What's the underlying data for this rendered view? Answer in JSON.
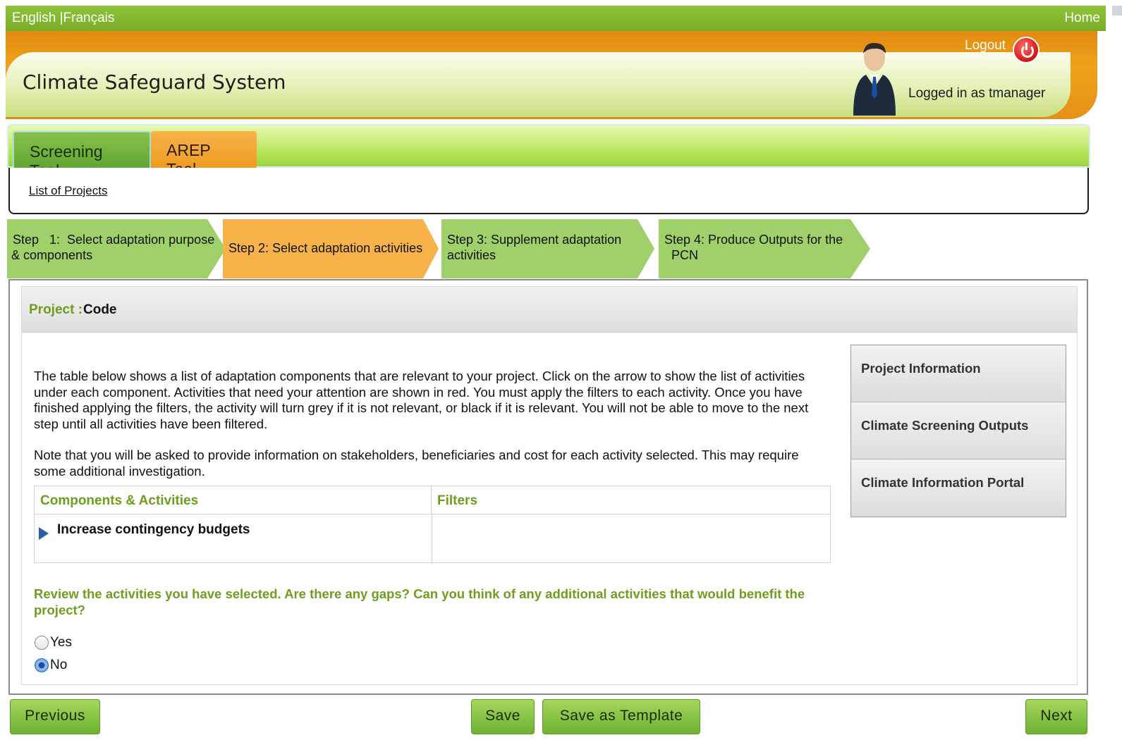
{
  "lang": {
    "english": "English",
    "separator": " |",
    "french": "Français"
  },
  "home": "Home",
  "header": {
    "title": "Climate Safeguard System",
    "logout": "Logout",
    "logged_in": "Logged in as tmanager"
  },
  "tabs": [
    {
      "label": "Screening Tool",
      "active": true
    },
    {
      "label": "AREP Tool",
      "active": false
    }
  ],
  "breadcrumb": {
    "link": "List of Projects"
  },
  "steps": [
    {
      "line1": "Step   1:  Select adaptation purpose",
      "line2": "& components",
      "state": "done"
    },
    {
      "line1": "Step 2: Select adaptation activities",
      "line2": "",
      "state": "current"
    },
    {
      "line1": "Step 3: Supplement adaptation",
      "line2": "activities",
      "state": "todo"
    },
    {
      "line1": "Step 4: Produce Outputs for the",
      "line2": "  PCN",
      "state": "todo"
    }
  ],
  "project": {
    "label": "Project : ",
    "code": "Code"
  },
  "intro": "The table below shows a list of adaptation components that are relevant to your project. Click on the arrow to show the list of activities under each component. Activities that need your attention are shown in red. You must apply the filters to each activity. Once you have finished applying the filters, the activity will turn grey if it is not relevant, or black if it is relevant. You will not be able to move to the next step until all activities have been filtered.",
  "note": "Note that you will be asked to provide information on stakeholders, beneficiaries and cost for each activity selected. This may require some additional investigation.",
  "table": {
    "headers": [
      "Components & Activities",
      "Filters"
    ],
    "rows": [
      {
        "component": "Increase contingency budgets",
        "filters": ""
      }
    ]
  },
  "question": "Review the activities you have selected. Are there any gaps? Can you think of any additional activities that would benefit the project?",
  "options": [
    {
      "label": "Yes",
      "selected": false
    },
    {
      "label": "No",
      "selected": true
    }
  ],
  "sidemenu": [
    "Project Information",
    "Climate Screening Outputs",
    "Climate Information Portal"
  ],
  "buttons": {
    "previous": "Previous",
    "save": "Save",
    "save_template": "Save as Template",
    "next": "Next"
  },
  "colors": {
    "green_bar": "#7db12a",
    "orange": "#f0a21a",
    "accent_text": "#6f9d1e",
    "step_done": "#9fd06a",
    "step_current": "#f7b34a"
  }
}
